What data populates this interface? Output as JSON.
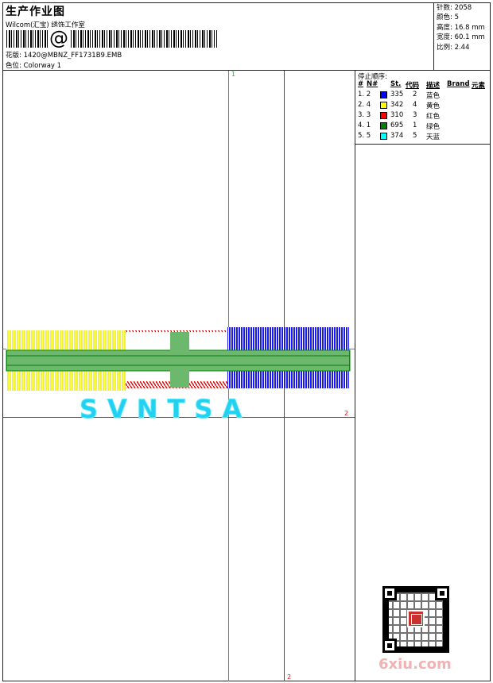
{
  "header": {
    "title": "生产作业图",
    "subtitle": "Wilcom(汇宝) 绣饰工作室",
    "barcode_symbol": "@",
    "design_label": "花版: 1420@MBNZ_FF1731B9.EMB",
    "colorway_label": "色位: Colorway 1"
  },
  "stats": {
    "stitches": "针数: 2058",
    "colors": "颜色: 5",
    "height": "高度: 16.8 mm",
    "width": "宽度: 60.1 mm",
    "scale": "比例: 2.44"
  },
  "stop_sequence": {
    "title": "停止顺序:",
    "columns": [
      "#",
      "N#",
      "St.",
      "代码",
      "描述",
      "Brand",
      "元素"
    ],
    "rows": [
      {
        "idx": "1. 2",
        "st": "335",
        "code": "2",
        "desc": "蓝色",
        "color": "#0000ff"
      },
      {
        "idx": "2. 4",
        "st": "342",
        "code": "4",
        "desc": "黄色",
        "color": "#ffff00"
      },
      {
        "idx": "3. 3",
        "st": "310",
        "code": "3",
        "desc": "红色",
        "color": "#ff0000"
      },
      {
        "idx": "4. 1",
        "st": "695",
        "code": "1",
        "desc": "绿色",
        "color": "#008000"
      },
      {
        "idx": "5. 5",
        "st": "374",
        "code": "5",
        "desc": "天蓝",
        "color": "#00ffff"
      }
    ]
  },
  "guides": {
    "green_label_top": "1",
    "red_label_right": "2",
    "red_label_bottom": "2",
    "green_color": "#18c018",
    "red_color": "#d01818"
  },
  "design": {
    "lettering": "SVNTSA"
  },
  "footer": {
    "site": "6xiu.com"
  }
}
